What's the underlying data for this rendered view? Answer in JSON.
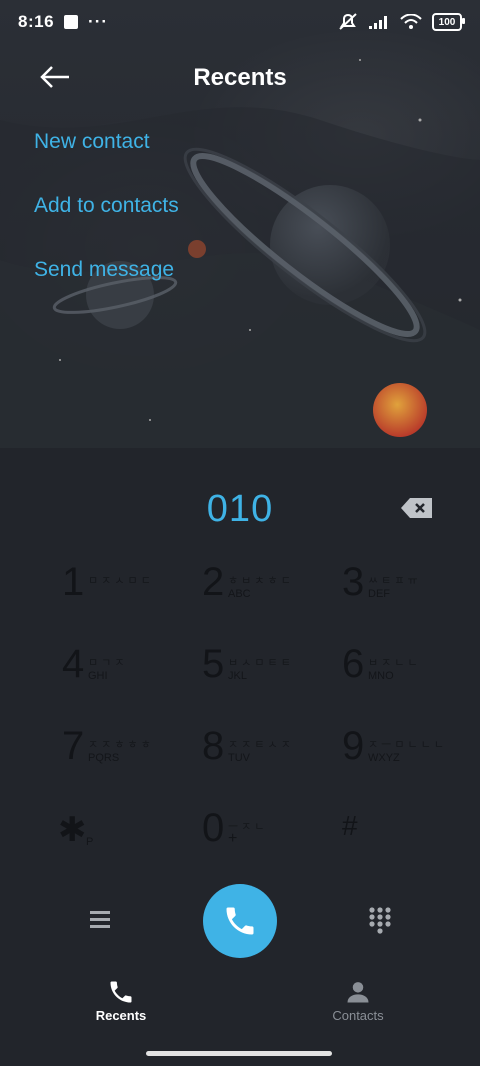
{
  "status_bar": {
    "time": "8:16",
    "dots": "···",
    "battery": "100"
  },
  "header": {
    "title": "Recents"
  },
  "actions": [
    {
      "label": "New contact"
    },
    {
      "label": "Add to contacts"
    },
    {
      "label": "Send message"
    }
  ],
  "dial": {
    "number": "010"
  },
  "keypad": {
    "rows": [
      [
        {
          "digit": "1",
          "sub1": "ㅁ ㅈ ㅅ ㅁ ㄷ",
          "sub2": ""
        },
        {
          "digit": "2",
          "sub1": "ㅎ ㅂ ㅊ ㅎ ㄷ",
          "sub2": "ABC"
        },
        {
          "digit": "3",
          "sub1": "ㅆ ㅌ ㅍ ㅠ",
          "sub2": "DEF"
        }
      ],
      [
        {
          "digit": "4",
          "sub1": "ㅁ ㄱ ㅈ",
          "sub2": "GHI"
        },
        {
          "digit": "5",
          "sub1": "ㅂ ㅅ ㅁ ㅌ ㅌ",
          "sub2": "JKL"
        },
        {
          "digit": "6",
          "sub1": "ㅂ ㅈ ㄴ ㄴ",
          "sub2": "MNO"
        }
      ],
      [
        {
          "digit": "7",
          "sub1": "ㅈ ㅈ ㅎ ㅎ ㅎ",
          "sub2": "PQRS"
        },
        {
          "digit": "8",
          "sub1": "ㅈ ㅈ ㅌ ㅅ ㅈ",
          "sub2": "TUV"
        },
        {
          "digit": "9",
          "sub1": "ㅈ ㅡ ㅁ ㄴ ㄴ ㄴ",
          "sub2": "WXYZ"
        }
      ],
      [
        {
          "digit": "✱",
          "sub1": "",
          "sub2": "P"
        },
        {
          "digit": "0",
          "sub1": "ㅡ ㅈ ㄴ",
          "sub2": "+"
        },
        {
          "digit": "#",
          "sub1": "",
          "sub2": ""
        }
      ]
    ]
  },
  "nav": {
    "recents": "Recents",
    "contacts": "Contacts"
  },
  "colors": {
    "accent": "#3fb3e6",
    "background": "#22252b"
  },
  "icons": [
    "back-arrow-icon",
    "backspace-icon",
    "menu-icon",
    "phone-icon",
    "dialpad-icon",
    "contact-person-icon",
    "mute-icon",
    "signal-icon",
    "wifi-icon",
    "battery-icon"
  ]
}
